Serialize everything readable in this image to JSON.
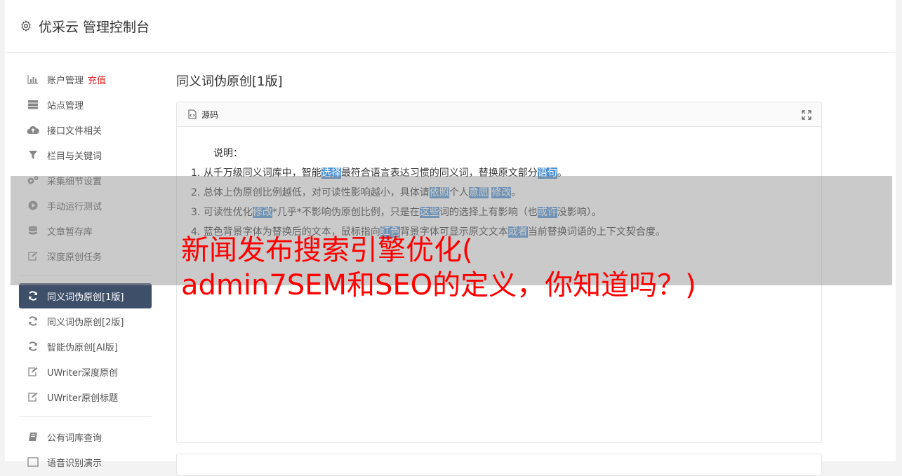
{
  "header": {
    "title": "优采云 管理控制台"
  },
  "sidebar": {
    "group1": [
      {
        "icon": "bar-chart-icon",
        "label": "账户管理",
        "extra": "充值"
      },
      {
        "icon": "server-icon",
        "label": "站点管理"
      },
      {
        "icon": "cloud-upload-icon",
        "label": "接口文件相关"
      },
      {
        "icon": "filter-icon",
        "label": "栏目与关键词"
      },
      {
        "icon": "cogs-icon",
        "label": "采集细节设置"
      },
      {
        "icon": "play-circle-icon",
        "label": "手动运行测试"
      },
      {
        "icon": "database-icon",
        "label": "文章暂存库"
      },
      {
        "icon": "edit-icon",
        "label": "深度原创任务"
      }
    ],
    "group2": [
      {
        "icon": "refresh-icon",
        "label": "同义词伪原创[1版]",
        "active": true
      },
      {
        "icon": "refresh-icon",
        "label": "同义词伪原创[2版]"
      },
      {
        "icon": "refresh-icon",
        "label": "智能伪原创[AI版]"
      },
      {
        "icon": "edit-icon",
        "label": "UWriter深度原创"
      },
      {
        "icon": "edit-icon",
        "label": "UWriter原创标题"
      }
    ],
    "group3": [
      {
        "icon": "book-icon",
        "label": "公有词库查询"
      },
      {
        "icon": "image-icon",
        "label": "语音识别演示"
      }
    ]
  },
  "main": {
    "page_title": "同义词伪原创[1版]",
    "panel_label": "源码",
    "intro": "说明：",
    "lines": [
      {
        "num": "1.",
        "segments": [
          {
            "t": "从千万级同义词库中，智能"
          },
          {
            "t": "选择",
            "hl": true
          },
          {
            "t": "最符合语言表达习惯的同义词，替换原文部分"
          },
          {
            "t": "语句",
            "hl": true
          },
          {
            "t": "。"
          }
        ]
      },
      {
        "num": "2.",
        "segments": [
          {
            "t": "总体上伪原创比例越低，对可读性影响越小，具体请"
          },
          {
            "t": "依照",
            "hl": true
          },
          {
            "t": "个人"
          },
          {
            "t": "意愿",
            "hl": true
          },
          {
            "t": " "
          },
          {
            "t": "修改",
            "hl": true
          },
          {
            "t": "。"
          }
        ]
      },
      {
        "num": "3.",
        "segments": [
          {
            "t": "可读性优化"
          },
          {
            "t": "修改",
            "hl": true
          },
          {
            "t": "*几乎*不影响伪原创比例，只是在"
          },
          {
            "t": "这些",
            "hl": true
          },
          {
            "t": "词的选择上有影响（也"
          },
          {
            "t": "或许",
            "hl": true
          },
          {
            "t": "没影响）。"
          }
        ]
      },
      {
        "num": "4.",
        "segments": [
          {
            "t": "蓝色背景字体为替换后的文本，鼠标指向"
          },
          {
            "t": "红色",
            "hl": true
          },
          {
            "t": "背景字体可显示原文文本"
          },
          {
            "t": "或者",
            "hl": true
          },
          {
            "t": "当前替换词语的上下文契合度。"
          }
        ]
      }
    ]
  },
  "overlay": {
    "line1": "新闻发布搜索引擎优化(",
    "line2": "admin7SEM和SEO的定义，你知道吗？)"
  },
  "colors": {
    "active_bg": "#3e4f6a",
    "highlight": "#4a8fd3",
    "overlay_text": "#ff0000",
    "recharge": "#e02424"
  }
}
